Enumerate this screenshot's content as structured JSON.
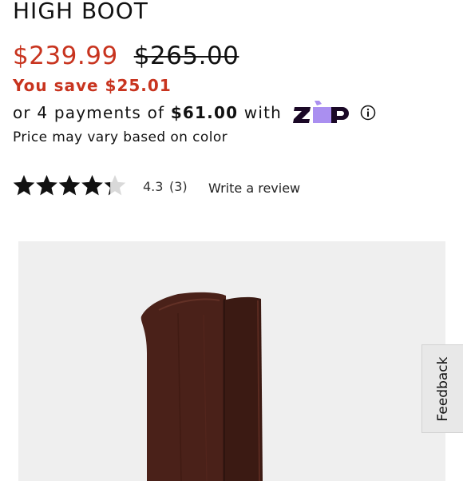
{
  "product": {
    "title": "HIGH BOOT",
    "price_current": "$239.99",
    "price_original": "$265.00",
    "savings": "You save $25.01",
    "installments": {
      "prefix": "or 4 payments of ",
      "amount": "$61.00",
      "suffix": " with",
      "provider_icon": "zip-logo",
      "info_icon": "info-icon"
    },
    "color_note": "Price may vary based on color"
  },
  "rating": {
    "value": "4.3",
    "count": "(3)",
    "stars_fraction": 0.86,
    "stars_total": 5,
    "write_review": "Write a review"
  },
  "feedback": {
    "label": "Feedback"
  },
  "colors": {
    "sale_price": "#c8341f",
    "text": "#111111",
    "image_background": "#efefef",
    "boot_suede": "#4a2119",
    "zip_purple": "#aa8ff0",
    "zip_navy": "#1a0826"
  }
}
